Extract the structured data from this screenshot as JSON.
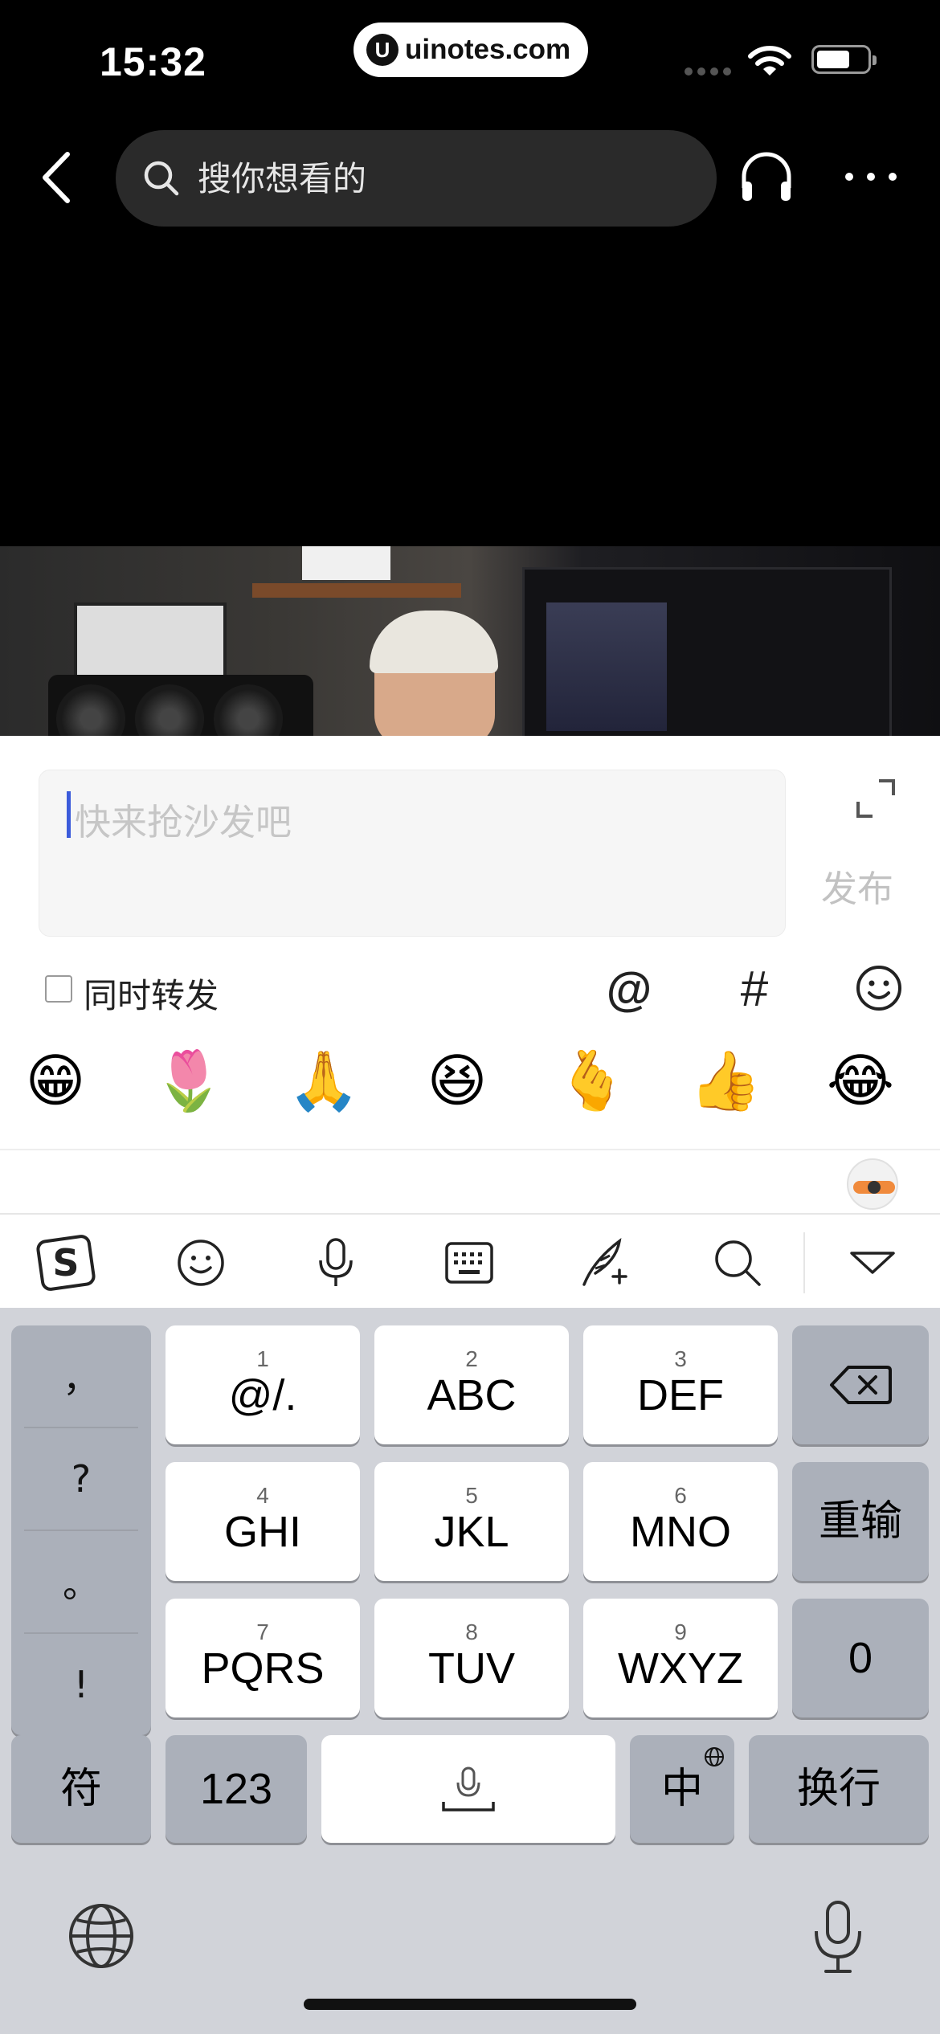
{
  "status_bar": {
    "time": "15:32",
    "url": "uinotes.com",
    "url_logo": "U"
  },
  "header": {
    "search_placeholder": "搜你想看的",
    "icons": [
      "back-icon",
      "search-icon",
      "headphone-icon",
      "more-icon"
    ]
  },
  "comment": {
    "placeholder": "快来抢沙发吧",
    "publish_label": "发布",
    "forward_label": "同时转发",
    "forward_checked": false,
    "at_symbol": "@",
    "hash_symbol": "#",
    "accent_color": "#3b5bdb"
  },
  "emojis": [
    "😁",
    "🌷",
    "🙏",
    "😆",
    "🫰",
    "👍",
    "😂"
  ],
  "ime_toolbar": {
    "icons": [
      "sogou-logo-icon",
      "emoji-icon",
      "microphone-icon",
      "keyboard-icon",
      "handwriting-icon",
      "search-icon",
      "collapse-icon"
    ]
  },
  "keyboard": {
    "punctuation": [
      "，",
      "?",
      "。",
      "!"
    ],
    "keys": [
      {
        "num": "1",
        "label": "@/."
      },
      {
        "num": "2",
        "label": "ABC"
      },
      {
        "num": "3",
        "label": "DEF"
      },
      {
        "num": "4",
        "label": "GHI"
      },
      {
        "num": "5",
        "label": "JKL"
      },
      {
        "num": "6",
        "label": "MNO"
      },
      {
        "num": "7",
        "label": "PQRS"
      },
      {
        "num": "8",
        "label": "TUV"
      },
      {
        "num": "9",
        "label": "WXYZ"
      }
    ],
    "retype": "重输",
    "zero": "0",
    "symbols": "符",
    "numbers": "123",
    "chinese": "中",
    "enter": "换行"
  }
}
